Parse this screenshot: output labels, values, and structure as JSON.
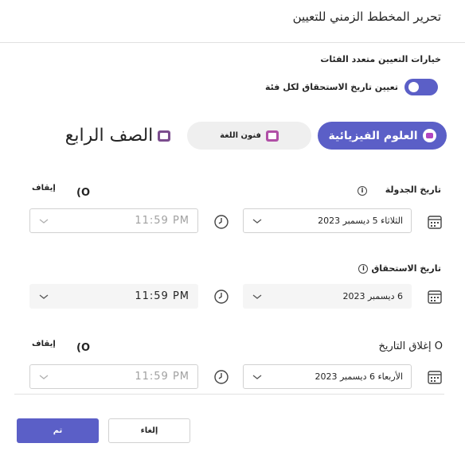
{
  "dialog": {
    "title": "تحرير المخطط الزمني للتعيين"
  },
  "options": {
    "title": "خيارات التعيين متعدد الفئات",
    "toggle_label": "تعيين تاريخ الاستحقاق لكل فئة",
    "toggle_on": true
  },
  "class_tabs": [
    {
      "label": "العلوم الفيزيائية",
      "active": true
    },
    {
      "label": "فنون اللغة",
      "active": false
    },
    {
      "label": "الصف الرابع",
      "active": false
    }
  ],
  "schedule": {
    "label": "تاريخ الجدولة",
    "toggle_text": "(O",
    "toggle_state": "إيقاف",
    "date": "الثلاثاء  5 ديسمبر 2023",
    "time": "11:59 PM"
  },
  "due": {
    "label": "تاريخ الاستحقاق",
    "date": "6 ديسمبر 2023",
    "time": "11:59 PM"
  },
  "close": {
    "label": "إغلاق التاريخ O",
    "toggle_text": "(O",
    "toggle_state": "إيقاف",
    "date": "الأربعاء  6 ديسمبر 2023",
    "time": "11:59 PM"
  },
  "footer": {
    "done_label": "تم",
    "cancel_label": "إلغاء"
  },
  "colors": {
    "accent": "#5b5fc7",
    "tab_inactive": "#efefef"
  }
}
